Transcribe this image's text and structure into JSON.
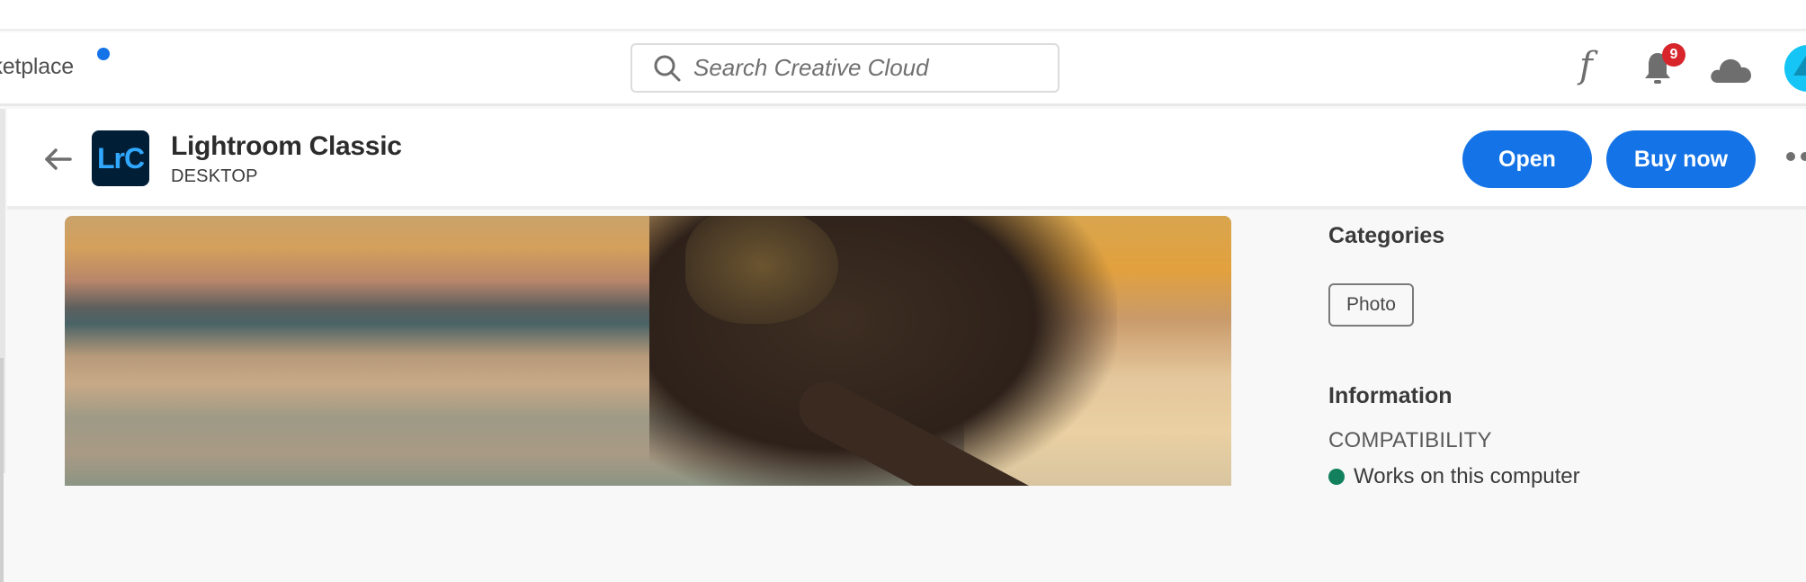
{
  "topnav": {
    "marketplace_label": "Marketplace",
    "marketplace_has_notification": true,
    "search": {
      "placeholder": "Search Creative Cloud",
      "value": ""
    },
    "icons": [
      "fonts-icon",
      "bell-icon",
      "cloud-icon",
      "avatar"
    ],
    "notifications_count": "9"
  },
  "product": {
    "back_label": "Back",
    "logo_text": "LrC",
    "title": "Lightroom Classic",
    "platform": "DESKTOP",
    "actions": {
      "open_label": "Open",
      "buy_label": "Buy now",
      "more_label": "More options"
    }
  },
  "hero": {
    "alt": "Lightroom Classic feature image"
  },
  "sidebar": {
    "categories_heading": "Categories",
    "categories": [
      "Photo"
    ],
    "information_heading": "Information",
    "compatibility_label": "COMPATIBILITY",
    "compatibility_status": "Works on this computer"
  },
  "colors": {
    "accent": "#1473e6",
    "badge": "#d7252b",
    "lrc_bg": "#001e36",
    "lrc_fg": "#31a8ff",
    "status_ok": "#12805c"
  }
}
